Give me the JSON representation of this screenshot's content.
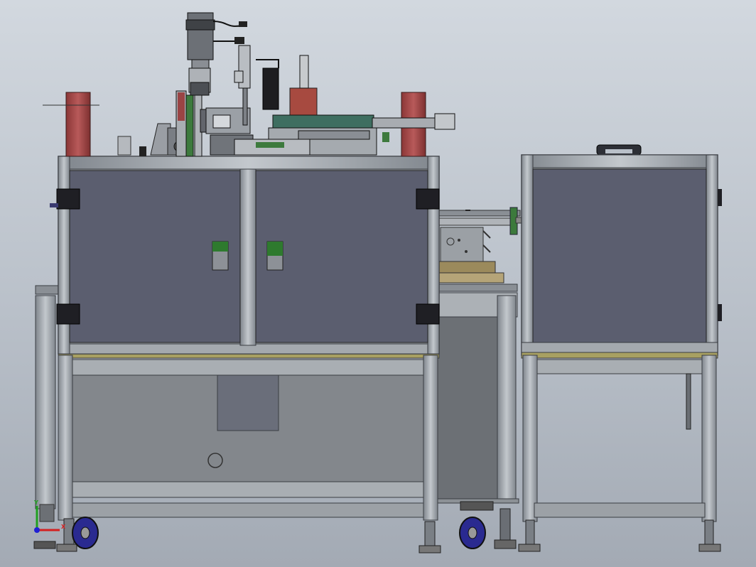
{
  "view": {
    "background_top": "#d2d8df",
    "background_bottom": "#a3aab4"
  },
  "colors": {
    "frame": "#9aa0a6",
    "panel": "#5a5d6e",
    "red_post": "#a04848",
    "green": "#3c7a3c",
    "caster_blue": "#2a2a90",
    "axis_x": "#d42020",
    "axis_y": "#20a020",
    "axis_z": "#2020d4"
  },
  "model": {
    "subject": "automated-machine-cabinet-cad-view",
    "parts": [
      "main-cabinet",
      "side-cabinet",
      "servo-motor",
      "pneumatic-cylinder",
      "conveyor-module",
      "caster-wheel"
    ]
  },
  "triad": {
    "x_label": "X",
    "y_label": "Y"
  }
}
